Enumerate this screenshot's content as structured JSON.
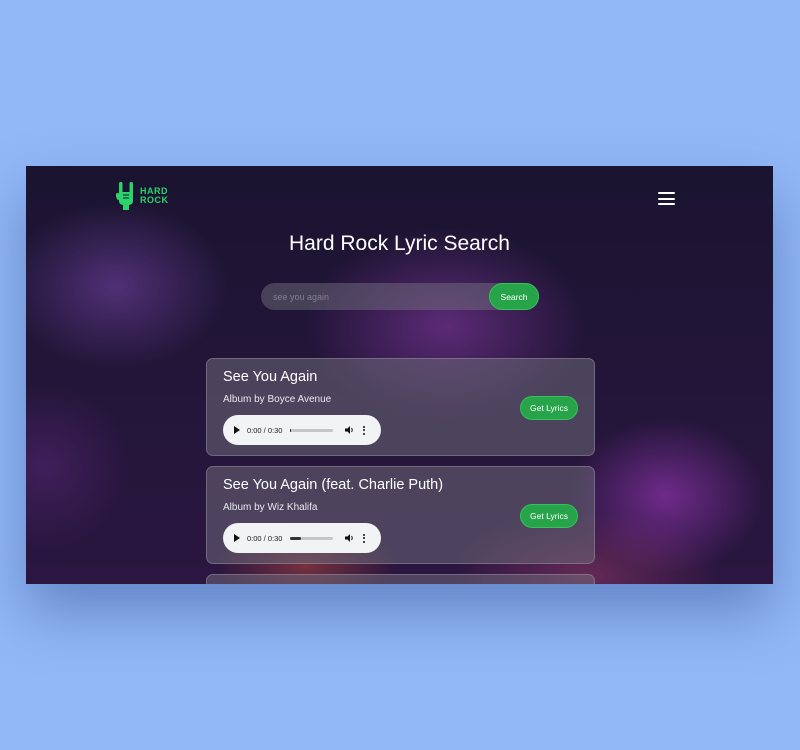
{
  "header": {
    "logo_line1": "HARD",
    "logo_line2": "ROCK",
    "logo_icon": "rock-hand-icon",
    "menu_icon": "hamburger-menu-icon"
  },
  "title": "Hard Rock Lyric Search",
  "search": {
    "value": "",
    "placeholder": "see you again",
    "button_label": "Search"
  },
  "results": [
    {
      "title": "See You Again",
      "album": "Album by Boyce Avenue",
      "time": "0:00 / 0:30",
      "progress": 0.02,
      "lyrics_label": "Get Lyrics"
    },
    {
      "title": "See You Again (feat. Charlie Puth)",
      "album": "Album by Wiz Khalifa",
      "time": "0:00 / 0:30",
      "progress": 0.25,
      "lyrics_label": "Get Lyrics"
    }
  ],
  "colors": {
    "accent": "#27a34a",
    "accent_border": "#35c15b",
    "logo": "#2bd46a",
    "page_background": "#93b8f7"
  }
}
